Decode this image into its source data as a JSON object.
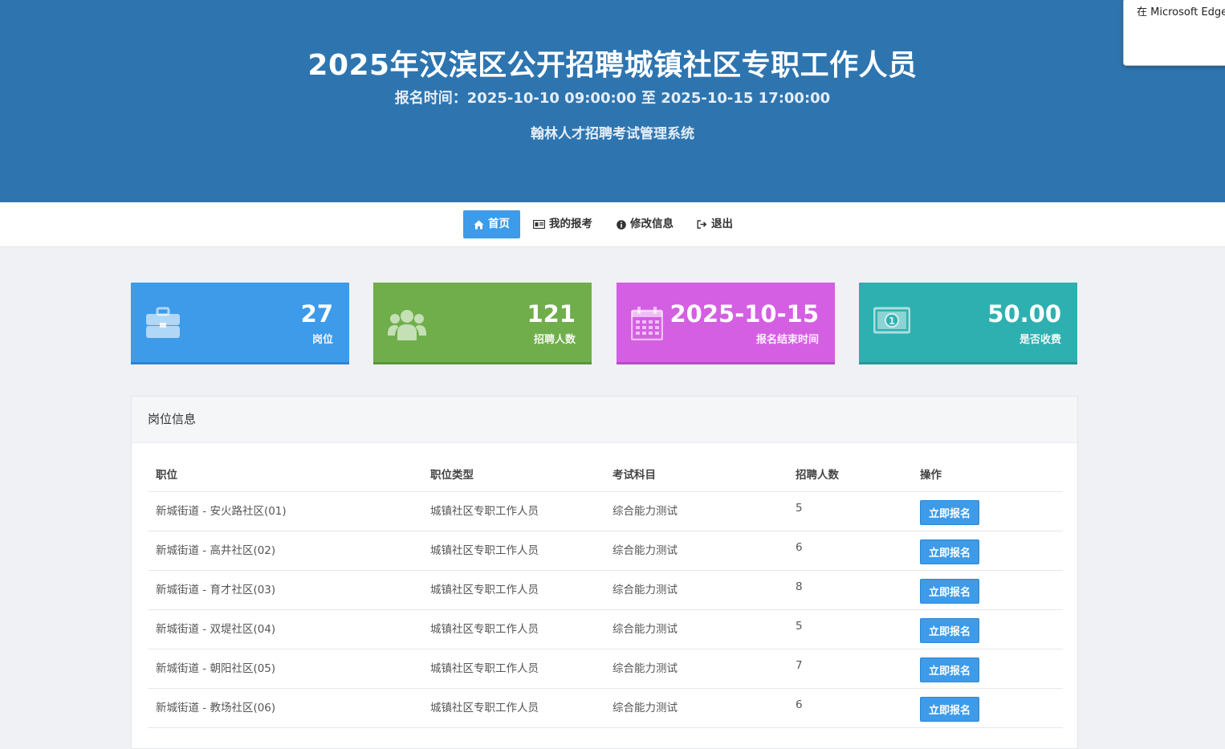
{
  "header": {
    "title": "2025年汉滨区公开招聘城镇社区专职工作人员",
    "period": "报名时间：2025-10-10 09:00:00 至 2025-10-15 17:00:00",
    "system_name": "翰林人才招聘考试管理系统"
  },
  "edge_popup": {
    "text": "在 Microsoft Edge 多"
  },
  "nav": {
    "items": [
      {
        "label": "首页",
        "icon": "home-icon",
        "active": true
      },
      {
        "label": "我的报考",
        "icon": "id-card-icon",
        "active": false
      },
      {
        "label": "修改信息",
        "icon": "info-circle-icon",
        "active": false
      },
      {
        "label": "退出",
        "icon": "sign-out-icon",
        "active": false
      }
    ]
  },
  "stats": [
    {
      "value": "27",
      "label": "岗位",
      "icon": "briefcase-icon",
      "color": "#3d9be9"
    },
    {
      "value": "121",
      "label": "招聘人数",
      "icon": "users-icon",
      "color": "#6fae4a"
    },
    {
      "value": "2025-10-15",
      "label": "报名结束时间",
      "icon": "calendar-icon",
      "color": "#d45fe3"
    },
    {
      "value": "50.00",
      "label": "是否收费",
      "icon": "money-icon",
      "color": "#2fb0b0"
    }
  ],
  "panel": {
    "title": "岗位信息",
    "columns": [
      "职位",
      "职位类型",
      "考试科目",
      "招聘人数",
      "操作"
    ],
    "rows": [
      {
        "position": "新城街道 - 安火路社区(01)",
        "type": "城镇社区专职工作人员",
        "subject": "综合能力测试",
        "count": "5",
        "action": "立即报名"
      },
      {
        "position": "新城街道 - 高井社区(02)",
        "type": "城镇社区专职工作人员",
        "subject": "综合能力测试",
        "count": "6",
        "action": "立即报名"
      },
      {
        "position": "新城街道 - 育才社区(03)",
        "type": "城镇社区专职工作人员",
        "subject": "综合能力测试",
        "count": "8",
        "action": "立即报名"
      },
      {
        "position": "新城街道 - 双堤社区(04)",
        "type": "城镇社区专职工作人员",
        "subject": "综合能力测试",
        "count": "5",
        "action": "立即报名"
      },
      {
        "position": "新城街道 - 朝阳社区(05)",
        "type": "城镇社区专职工作人员",
        "subject": "综合能力测试",
        "count": "7",
        "action": "立即报名"
      },
      {
        "position": "新城街道 - 教场社区(06)",
        "type": "城镇社区专职工作人员",
        "subject": "综合能力测试",
        "count": "6",
        "action": "立即报名"
      }
    ]
  }
}
